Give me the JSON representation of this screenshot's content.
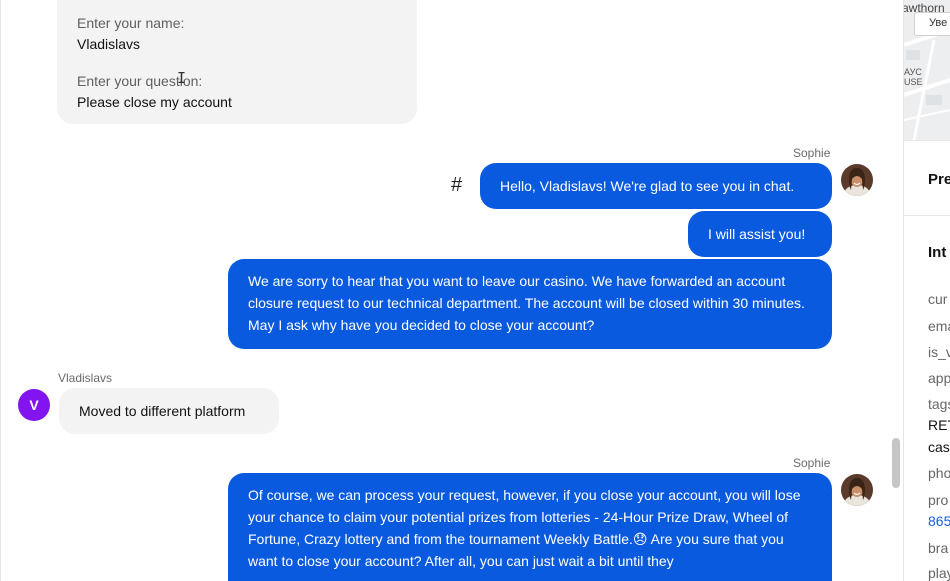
{
  "form": {
    "name_label": "Enter your name:",
    "name_value": "Vladislavs",
    "question_label": "Enter your question:",
    "question_value": "Please close my account"
  },
  "messages": {
    "agent_name_1": "Sophie",
    "hash_symbol": "#",
    "greeting": "Hello, Vladislavs! We're glad to see you in chat.",
    "assist": "I will assist you!",
    "sorry": "We are sorry to hear that you want to leave our casino. We have forwarded an account closure request to our technical department. The account will be closed within 30 minutes. May I ask why have you decided to close your account?",
    "user_name": "Vladislavs",
    "user_initial": "V",
    "user_reply": "Moved to different platform",
    "agent_name_2": "Sophie",
    "process_text": "Of course, we can process your request, however, if you close your account, you will lose your chance to claim your potential prizes from lotteries - 24-Hour Prize Draw, Wheel of Fortune, Crazy lottery and from the tournament Weekly Battle.😞 Are you sure that you want to close your account? After all, you can just wait a bit until they"
  },
  "panel": {
    "map_street": "awthorn",
    "map_button": "Уве",
    "map_place": "АУС\nUSE",
    "heading_1": "Pre",
    "heading_2": "Int",
    "fields": [
      "cur",
      "ema",
      "is_v",
      "app",
      "tags"
    ],
    "tag_value_1": "RET",
    "tag_value_2": "cas",
    "field_phone": "pho",
    "field_prof": "pro",
    "phone_link": "865",
    "field_brand": "bra",
    "field_play": "play"
  },
  "colors": {
    "agent_bubble": "#0a5ae0",
    "user_avatar": "#8214f0",
    "user_bubble": "#f3f3f3"
  }
}
